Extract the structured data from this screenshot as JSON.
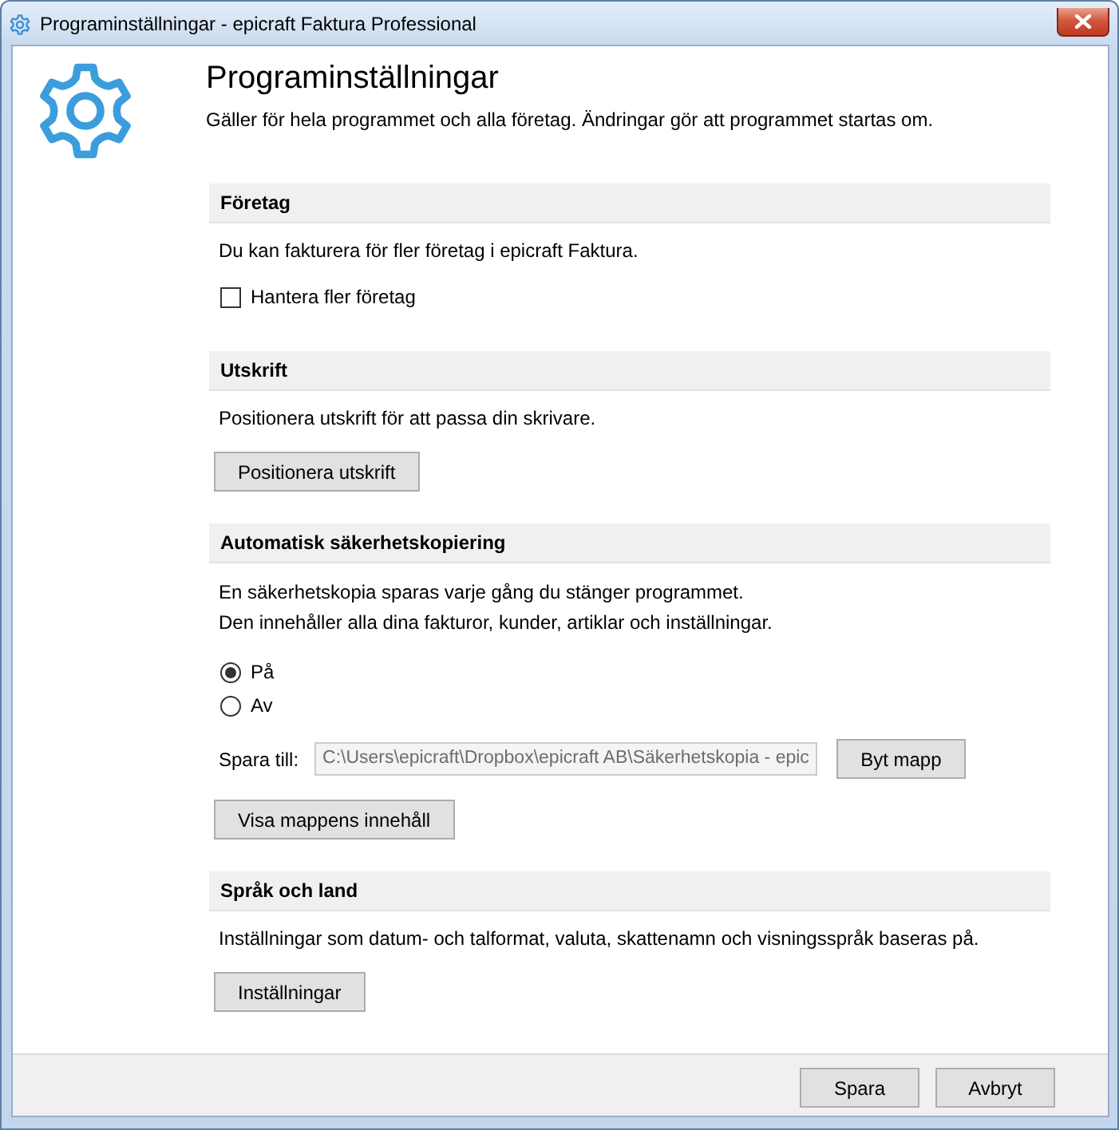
{
  "window": {
    "title": "Programinställningar - epicraft Faktura Professional"
  },
  "header": {
    "title": "Programinställningar",
    "subtitle": "Gäller för hela programmet och alla företag. Ändringar gör att programmet startas om."
  },
  "sections": [
    {
      "title": "Företag",
      "description": [
        "Du kan fakturera för fler företag i epicraft Faktura."
      ],
      "controls": [
        {
          "kind": "checkbox",
          "label": "Hantera fler företag",
          "checked": false
        }
      ]
    },
    {
      "title": "Utskrift",
      "description": [
        "Positionera utskrift för att passa din skrivare."
      ],
      "controls": [
        {
          "kind": "button",
          "label": "Positionera utskrift"
        }
      ]
    },
    {
      "title": "Automatisk säkerhetskopiering",
      "description": [
        "En säkerhetskopia sparas varje gång du stänger programmet.",
        "Den innehåller alla dina fakturor, kunder, artiklar och inställningar."
      ],
      "controls": [
        {
          "kind": "radio",
          "options": [
            {
              "label": "På",
              "selected": true
            },
            {
              "label": "Av",
              "selected": false
            }
          ]
        },
        {
          "kind": "path",
          "label": "Spara till:",
          "value": "C:\\Users\\epicraft\\Dropbox\\epicraft AB\\Säkerhetskopia - epic",
          "disabled": true,
          "button": "Byt mapp"
        },
        {
          "kind": "button",
          "label": "Visa mappens innehåll"
        }
      ]
    },
    {
      "title": "Språk och land",
      "description": [
        "Inställningar som datum- och talformat, valuta, skattenamn och visningsspråk baseras på."
      ],
      "controls": [
        {
          "kind": "button",
          "label": "Inställningar"
        }
      ]
    }
  ],
  "footer": {
    "buttons": [
      "Spara",
      "Avbryt"
    ]
  }
}
